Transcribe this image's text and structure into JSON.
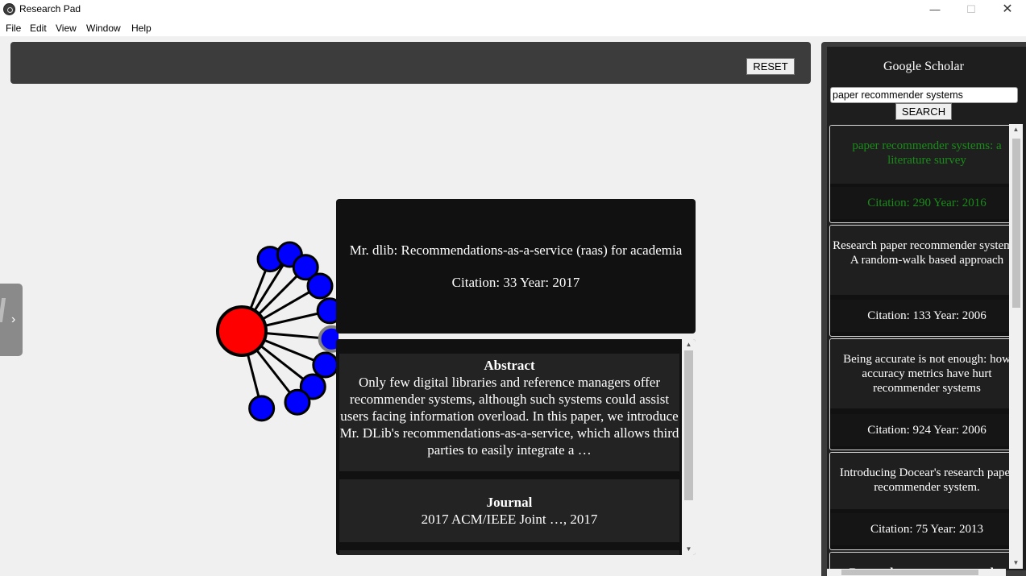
{
  "window": {
    "title": "Research Pad",
    "icon": "app-icon",
    "controls": {
      "minimize": "—",
      "maximize": "☐",
      "close": "✕"
    }
  },
  "menu": [
    "File",
    "Edit",
    "View",
    "Window",
    "Help"
  ],
  "toolbar": {
    "reset_label": "RESET"
  },
  "drawer": {
    "toggle_glyph": "›"
  },
  "graph": {
    "center_node_color": "#ff0000",
    "child_node_color": "#0000ff",
    "child_count": 10,
    "selected_child_index": 5
  },
  "paper": {
    "title": "Mr. dlib: Recommendations-as-a-service (raas) for academia",
    "citation_line": "Citation: 33 Year: 2017"
  },
  "details": {
    "abstract_heading": "Abstract",
    "abstract_text": "Only few digital libraries and reference managers offer recommender systems, although such systems could assist users facing information overload. In this paper, we introduce Mr. DLib's recommendations-as-a-service, which allows third parties to easily integrate a …",
    "journal_heading": "Journal",
    "journal_text": "2017 ACM/IEEE Joint …, 2017"
  },
  "sidebar": {
    "title": "Google Scholar",
    "search_value": "paper recommender systems",
    "search_button": "SEARCH",
    "results": [
      {
        "title": "paper recommender systems: a literature survey",
        "citation": "Citation: 290 Year: 2016",
        "color": "#1a8c1a"
      },
      {
        "title": "Research paper recommender systems: A random-walk based approach",
        "citation": "Citation: 133 Year: 2006",
        "color": "#ffffff"
      },
      {
        "title": "Being accurate is not enough: how accuracy metrics have hurt recommender systems",
        "citation": "Citation: 924 Year: 2006",
        "color": "#ffffff"
      },
      {
        "title": "Introducing Docear's research paper recommender system.",
        "citation": "Citation: 75 Year: 2013",
        "color": "#ffffff"
      },
      {
        "title": "Research paper recommender system",
        "citation": "",
        "color": "#ffffff"
      }
    ]
  }
}
